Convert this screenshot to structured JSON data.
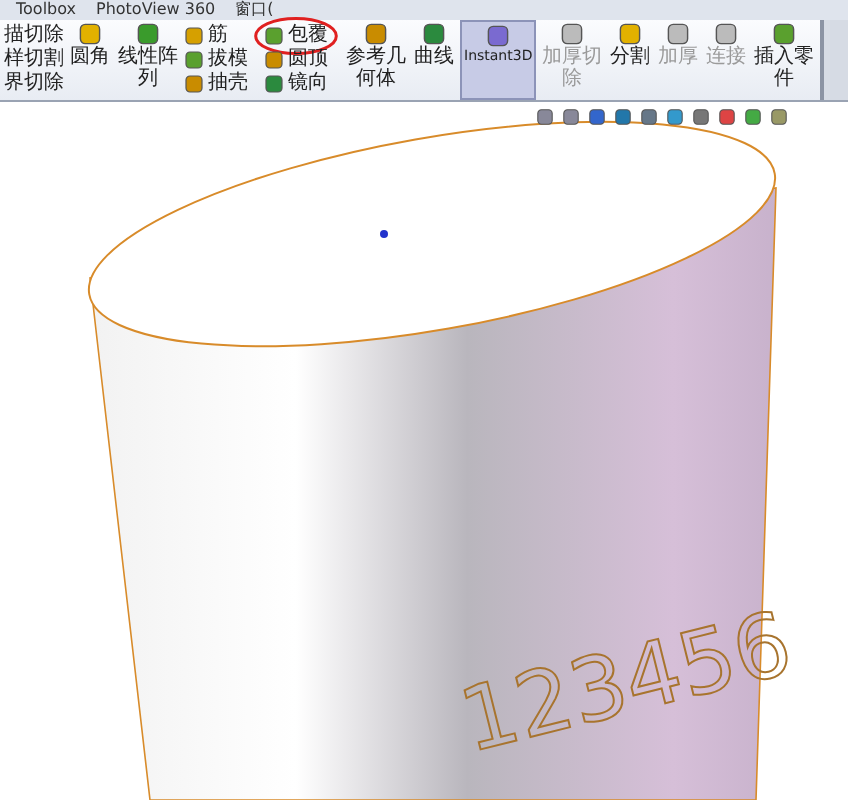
{
  "menu": [
    "Toolbox",
    "PhotoView 360",
    "窗口("
  ],
  "ribbon": {
    "cut_column": [
      "描切除",
      "样切割",
      "界切除"
    ],
    "items": [
      {
        "kind": "large",
        "label": "圆角",
        "disabled": false,
        "selected": false
      },
      {
        "kind": "large",
        "label": "线性阵列",
        "disabled": false,
        "selected": false
      },
      {
        "kind": "stack",
        "entries": [
          {
            "label": "筋",
            "circled": false
          },
          {
            "label": "拔模",
            "circled": false
          },
          {
            "label": "抽壳",
            "circled": false
          }
        ]
      },
      {
        "kind": "stack",
        "entries": [
          {
            "label": "包覆",
            "circled": true
          },
          {
            "label": "圆顶",
            "circled": false
          },
          {
            "label": "镜向",
            "circled": false
          }
        ]
      },
      {
        "kind": "large",
        "label": "参考几何体",
        "disabled": false,
        "selected": false
      },
      {
        "kind": "large",
        "label": "曲线",
        "disabled": false,
        "selected": false
      },
      {
        "kind": "large",
        "label": "Instant3D",
        "disabled": false,
        "selected": true
      },
      {
        "kind": "large",
        "label": "加厚切除",
        "disabled": true,
        "selected": false
      },
      {
        "kind": "large",
        "label": "分割",
        "disabled": false,
        "selected": false
      },
      {
        "kind": "large",
        "label": "加厚",
        "disabled": true,
        "selected": false
      },
      {
        "kind": "large",
        "label": "连接",
        "disabled": true,
        "selected": false
      },
      {
        "kind": "large",
        "label": "插入零件",
        "disabled": false,
        "selected": false
      }
    ]
  },
  "model": {
    "engraved_text": "123456"
  }
}
